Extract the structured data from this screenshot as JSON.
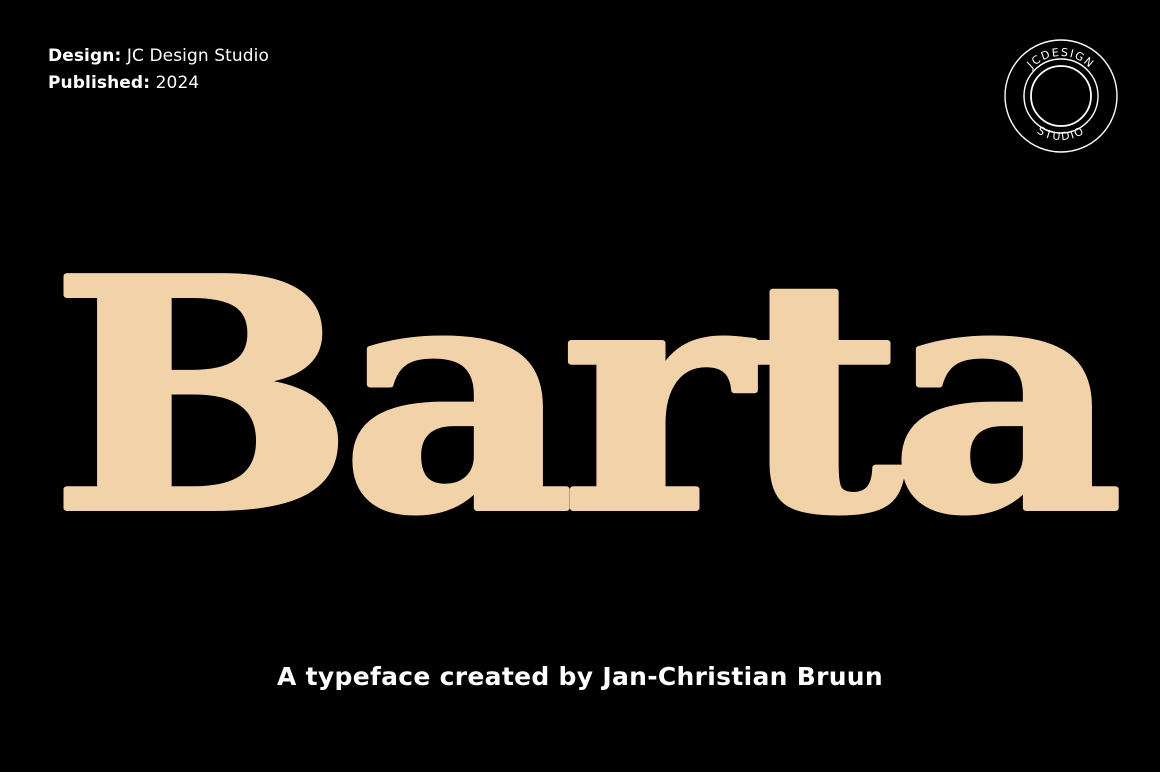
{
  "meta": {
    "design_label": "Design:",
    "design_value": "JC Design Studio",
    "published_label": "Published:",
    "published_value": "2024"
  },
  "logo": {
    "name": "jc-design-studio-seal",
    "text_top": "JCDESIGN",
    "text_bottom": "STUDIO"
  },
  "headline": {
    "text": "Barta",
    "color": "#f2d2a9"
  },
  "tagline": {
    "text": "A typeface created by Jan-Christian Bruun"
  },
  "colors": {
    "background": "#000000",
    "text": "#ffffff",
    "accent": "#f2d2a9"
  }
}
